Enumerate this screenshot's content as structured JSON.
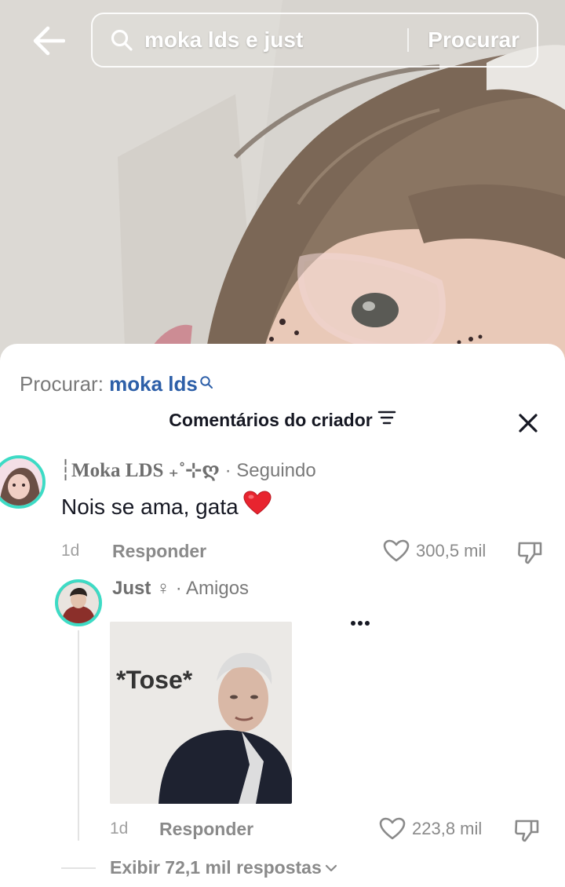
{
  "search": {
    "query": "moka lds e just",
    "submit_label": "Procurar"
  },
  "suggestion": {
    "prefix": "Procurar:",
    "term": "moka lds"
  },
  "comments_panel": {
    "title": "Comentários do criador"
  },
  "comment": {
    "username": "┆Moka LDS ₊˚⊹ღ",
    "relation": "· Seguindo",
    "text": "Nois se ama, gata",
    "time": "1d",
    "reply_label": "Responder",
    "likes": "300,5 mil"
  },
  "reply": {
    "username": "Just ♀",
    "relation": "· Amigos",
    "sticker_text": "*Tose*",
    "time": "1d",
    "reply_label": "Responder",
    "likes": "223,8 mil"
  },
  "view_replies_label": "Exibir 72,1 mil respostas",
  "colors": {
    "accent_link": "#2d5fa8",
    "avatar_ring": "#3ddbc5",
    "heart": "#e8242f",
    "text_primary": "#161823",
    "text_muted": "#8a8a8a"
  },
  "icons": [
    "back-arrow-icon",
    "search-icon",
    "filter-icon",
    "close-icon",
    "heart-outline-icon",
    "dislike-icon",
    "more-dots-icon",
    "chevron-down-icon"
  ]
}
